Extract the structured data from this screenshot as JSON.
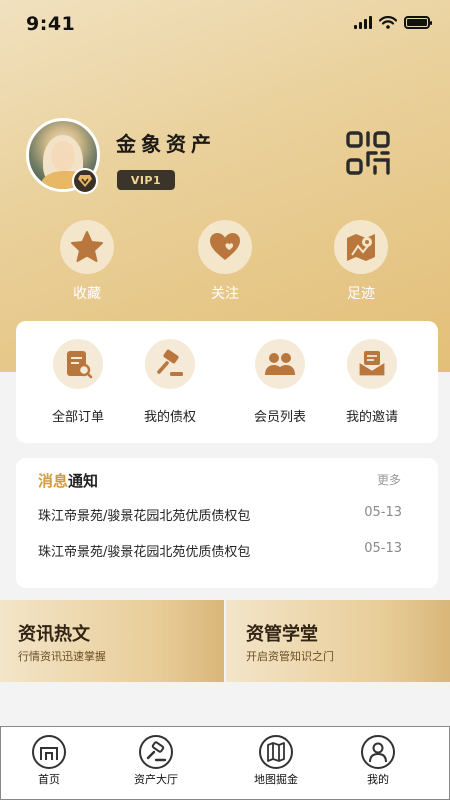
{
  "status_bar": {
    "time": "9:41"
  },
  "profile": {
    "name": "金象资产",
    "vip_label": "VIP1"
  },
  "quick_links": [
    {
      "label": "收藏",
      "icon": "star-icon"
    },
    {
      "label": "关注",
      "icon": "heart-icon"
    },
    {
      "label": "足迹",
      "icon": "map-pin-icon"
    }
  ],
  "menu": [
    {
      "label": "全部订单",
      "icon": "order-search-icon"
    },
    {
      "label": "我的债权",
      "icon": "gavel-icon"
    },
    {
      "label": "会员列表",
      "icon": "members-icon"
    },
    {
      "label": "我的邀请",
      "icon": "invitation-icon"
    }
  ],
  "notices": {
    "title_accent": "消息",
    "title_rest": "通知",
    "more_label": "更多",
    "items": [
      {
        "text": "珠江帝景苑/骏景花园北苑优质债权包",
        "date": "05-13"
      },
      {
        "text": "珠江帝景苑/骏景花园北苑优质债权包",
        "date": "05-13"
      }
    ]
  },
  "features": [
    {
      "title": "资讯热文",
      "subtitle": "行情资讯迅速掌握"
    },
    {
      "title": "资管学堂",
      "subtitle": "开启资管知识之门"
    }
  ],
  "tab_bar": [
    {
      "label": "首页",
      "icon": "home-icon"
    },
    {
      "label": "资产大厅",
      "icon": "auction-hall-icon"
    },
    {
      "label": "地图掘金",
      "icon": "map-icon"
    },
    {
      "label": "我的",
      "icon": "user-icon"
    }
  ],
  "colors": {
    "gold_header": "#e9cf98",
    "accent": "#d39b3e",
    "icon_brown": "#b9773d"
  }
}
